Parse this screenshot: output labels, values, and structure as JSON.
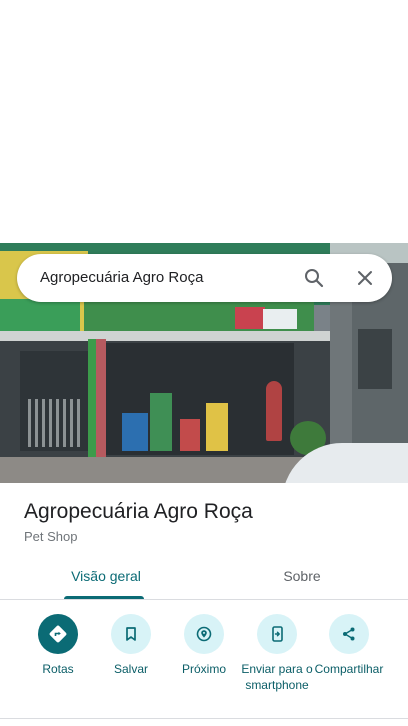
{
  "search": {
    "query": "Agropecuária Agro Roça"
  },
  "place": {
    "title": "Agropecuária Agro Roça",
    "category": "Pet Shop"
  },
  "tabs": [
    {
      "label": "Visão geral",
      "active": true
    },
    {
      "label": "Sobre",
      "active": false
    }
  ],
  "actions": [
    {
      "label": "Rotas",
      "icon": "directions-icon"
    },
    {
      "label": "Salvar",
      "icon": "bookmark-icon"
    },
    {
      "label": "Próximo",
      "icon": "nearby-icon"
    },
    {
      "label": "Enviar para o smartphone",
      "icon": "send-to-phone-icon"
    },
    {
      "label": "Compartilhar",
      "icon": "share-icon"
    }
  ],
  "colors": {
    "accent": "#0b6b75",
    "action_bg": "#d8f3f7",
    "secondary_text": "#70757a"
  }
}
